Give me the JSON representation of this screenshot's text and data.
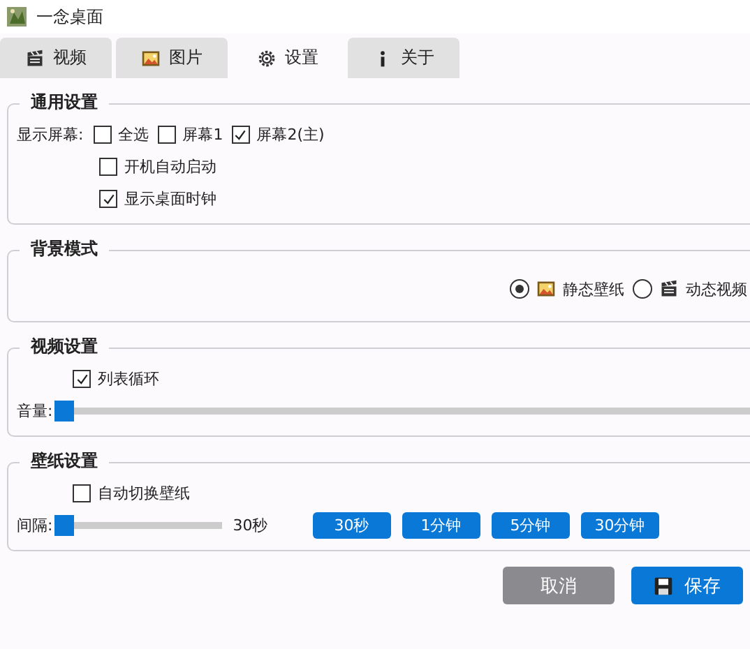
{
  "window": {
    "title": "一念桌面"
  },
  "tabs": [
    {
      "label": "视频",
      "selected": false
    },
    {
      "label": "图片",
      "selected": false
    },
    {
      "label": "设置",
      "selected": true
    },
    {
      "label": "关于",
      "selected": false
    }
  ],
  "general": {
    "title": "通用设置",
    "screens_label": "显示屏幕:",
    "screens": [
      {
        "label": "全选",
        "checked": false
      },
      {
        "label": "屏幕1",
        "checked": false
      },
      {
        "label": "屏幕2(主)",
        "checked": true
      }
    ],
    "options": [
      {
        "label": "开机自动启动",
        "checked": false
      },
      {
        "label": "显示桌面时钟",
        "checked": true
      }
    ]
  },
  "background": {
    "title": "背景模式",
    "modes": [
      {
        "label": "静态壁纸",
        "selected": true
      },
      {
        "label": "动态视频",
        "selected": false
      }
    ]
  },
  "video": {
    "title": "视频设置",
    "loop": {
      "label": "列表循环",
      "checked": true
    },
    "volume": {
      "label": "音量:",
      "level": 0
    }
  },
  "wallpaper": {
    "title": "壁纸设置",
    "auto": {
      "label": "自动切换壁纸",
      "checked": false
    },
    "interval": {
      "label": "间隔:",
      "level": 0,
      "reading": "30秒"
    },
    "presets": [
      "30秒",
      "1分钟",
      "5分钟",
      "30分钟"
    ]
  },
  "buttons": [
    {
      "label": "取消",
      "kind": "secondary"
    },
    {
      "label": "保存",
      "kind": "primary"
    }
  ]
}
